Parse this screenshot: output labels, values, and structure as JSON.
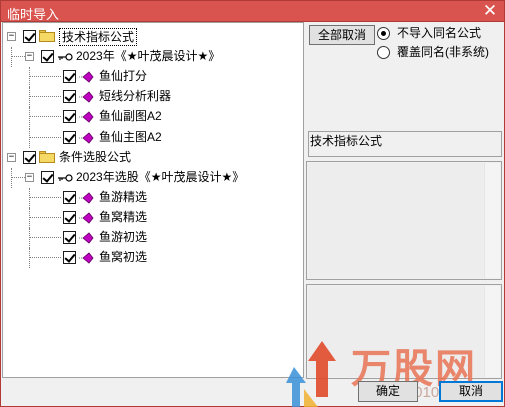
{
  "window": {
    "title": "临时导入",
    "close_glyph": "✕"
  },
  "tree": {
    "nodes": [
      {
        "label": "技术指标公式",
        "level": 0,
        "kind": "folder",
        "checked": true,
        "expanded": true,
        "selected": true
      },
      {
        "label": "2023年《★叶茂晨设计★》",
        "level": 1,
        "kind": "group",
        "checked": true,
        "expanded": true
      },
      {
        "label": "鱼仙打分",
        "level": 2,
        "kind": "formula",
        "checked": true
      },
      {
        "label": "短线分析利器",
        "level": 2,
        "kind": "formula",
        "checked": true
      },
      {
        "label": "鱼仙副图A2",
        "level": 2,
        "kind": "formula",
        "checked": true
      },
      {
        "label": "鱼仙主图A2",
        "level": 2,
        "kind": "formula",
        "checked": true
      },
      {
        "label": "条件选股公式",
        "level": 0,
        "kind": "folder",
        "checked": true,
        "expanded": true
      },
      {
        "label": "2023年选股《★叶茂晨设计★》",
        "level": 1,
        "kind": "group",
        "checked": true,
        "expanded": true
      },
      {
        "label": "鱼游精选",
        "level": 2,
        "kind": "formula",
        "checked": true
      },
      {
        "label": "鱼窝精选",
        "level": 2,
        "kind": "formula",
        "checked": true
      },
      {
        "label": "鱼游初选",
        "level": 2,
        "kind": "formula",
        "checked": true
      },
      {
        "label": "鱼窝初选",
        "level": 2,
        "kind": "formula",
        "checked": true
      }
    ],
    "expander_glyph": "−"
  },
  "controls": {
    "cancel_all_label": "全部取消",
    "radio_options": [
      {
        "label": "不导入同名公式",
        "selected": true
      },
      {
        "label": "覆盖同名(非系统)",
        "selected": false
      }
    ],
    "info_label": "技术指标公式",
    "ok_label": "确定",
    "cancel_label": "取消"
  },
  "watermark": {
    "text": "万股网",
    "url": "www.201082.com"
  },
  "colors": {
    "titlebar": "#d9534f",
    "accent": "#0078d7",
    "leaf_icon": "#c000c0",
    "folder": "#f6d865"
  }
}
